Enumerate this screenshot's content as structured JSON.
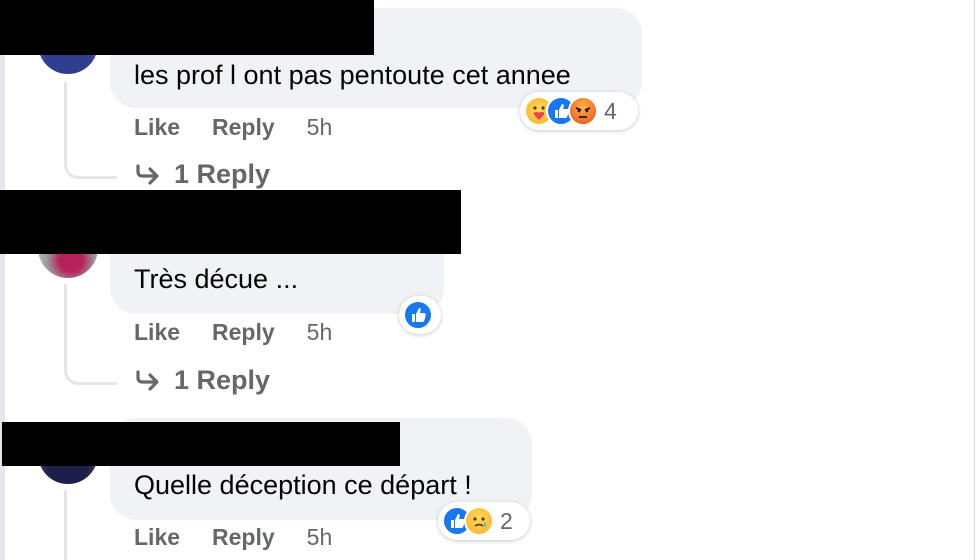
{
  "comments": [
    {
      "text": "les prof l ont pas pentoute cet annee",
      "actions": {
        "like": "Like",
        "reply": "Reply",
        "time": "5h"
      },
      "reactions": {
        "icons": [
          "care",
          "like",
          "angry"
        ],
        "count": "4"
      },
      "replies_label": "1 Reply"
    },
    {
      "text": "Très décue ...",
      "actions": {
        "like": "Like",
        "reply": "Reply",
        "time": "5h"
      },
      "reactions": {
        "icons": [
          "like"
        ],
        "count": ""
      },
      "replies_label": "1 Reply"
    },
    {
      "text": "Quelle déception ce départ !",
      "actions": {
        "like": "Like",
        "reply": "Reply",
        "time": "5h"
      },
      "reactions": {
        "icons": [
          "like",
          "sad"
        ],
        "count": "2"
      },
      "replies_label": ""
    }
  ],
  "colors": {
    "bubble": "#f0f2f5",
    "like_blue": "#1877f2",
    "angry": "#e94b1b",
    "care": "#f7b125",
    "secondary_text": "#65676b"
  }
}
